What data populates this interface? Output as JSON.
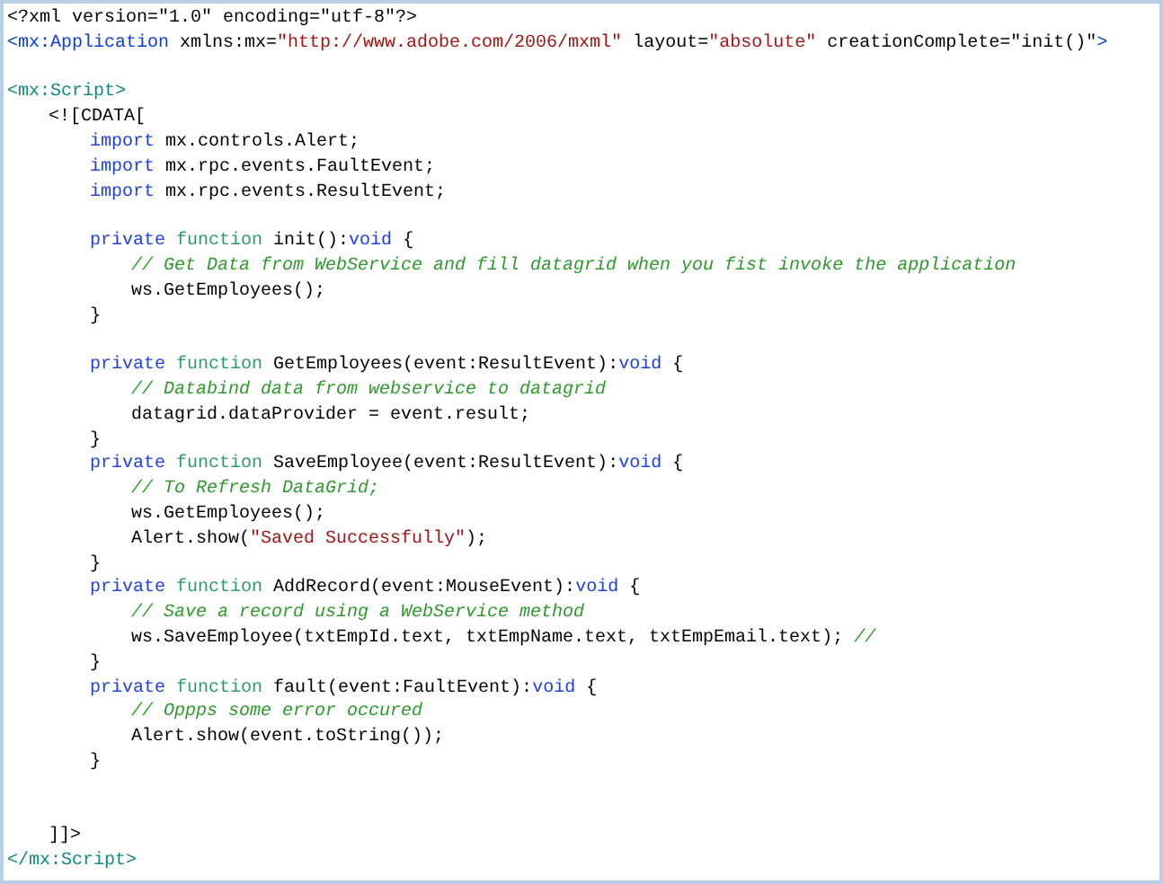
{
  "code_lines": [
    {
      "kind": "top",
      "tokens": [
        {
          "kind": "plain",
          "text": "<?xml version=\"1.0\" encoding=\"utf-8\"?>"
        }
      ]
    },
    {
      "kind": "top",
      "tokens": [
        {
          "kind": "tag",
          "text": "<mx:Application"
        },
        {
          "kind": "plain",
          "text": " xmlns:mx="
        },
        {
          "kind": "string",
          "text": "\"http://www.adobe.com/2006/mxml\""
        },
        {
          "kind": "plain",
          "text": " layout="
        },
        {
          "kind": "string",
          "text": "\"absolute\""
        },
        {
          "kind": "plain",
          "text": " creationComplete=\"init()\""
        },
        {
          "kind": "tag",
          "text": ">"
        }
      ]
    },
    {
      "kind": "blank"
    },
    {
      "kind": "top",
      "tokens": [
        {
          "kind": "script_tag",
          "text": "<mx:Script>"
        }
      ]
    },
    {
      "kind": "block",
      "tokens": [
        {
          "kind": "plain",
          "text": "<![CDATA["
        }
      ]
    },
    {
      "kind": "member",
      "tokens": [
        {
          "kind": "keyword",
          "text": "import"
        },
        {
          "kind": "plain",
          "text": " mx.controls.Alert;"
        }
      ]
    },
    {
      "kind": "member",
      "tokens": [
        {
          "kind": "keyword",
          "text": "import"
        },
        {
          "kind": "plain",
          "text": " mx.rpc.events.FaultEvent;"
        }
      ]
    },
    {
      "kind": "member",
      "tokens": [
        {
          "kind": "keyword",
          "text": "import"
        },
        {
          "kind": "plain",
          "text": " mx.rpc.events.ResultEvent;"
        }
      ]
    },
    {
      "kind": "blank"
    },
    {
      "kind": "member",
      "tokens": [
        {
          "kind": "keyword",
          "text": "private"
        },
        {
          "kind": "function_keyword",
          "text": " function"
        },
        {
          "kind": "plain",
          "text": " init():"
        },
        {
          "kind": "keyword",
          "text": "void"
        },
        {
          "kind": "plain",
          "text": " {"
        }
      ]
    },
    {
      "kind": "body",
      "tokens": [
        {
          "kind": "comment",
          "text": "// Get Data from WebService and fill datagrid when you fist invoke the application"
        }
      ]
    },
    {
      "kind": "body",
      "tokens": [
        {
          "kind": "plain",
          "text": "ws.GetEmployees();"
        }
      ]
    },
    {
      "kind": "member",
      "tokens": [
        {
          "kind": "plain",
          "text": "}"
        }
      ]
    },
    {
      "kind": "blank"
    },
    {
      "kind": "member",
      "tokens": [
        {
          "kind": "keyword",
          "text": "private"
        },
        {
          "kind": "function_keyword",
          "text": " function"
        },
        {
          "kind": "plain",
          "text": " GetEmployees(event:ResultEvent):"
        },
        {
          "kind": "keyword",
          "text": "void"
        },
        {
          "kind": "plain",
          "text": " {"
        }
      ]
    },
    {
      "kind": "body",
      "tokens": [
        {
          "kind": "comment",
          "text": "// Databind data from webservice to datagrid"
        }
      ]
    },
    {
      "kind": "body",
      "tokens": [
        {
          "kind": "plain",
          "text": "datagrid.dataProvider = event.result;"
        }
      ]
    },
    {
      "kind": "member",
      "tokens": [
        {
          "kind": "plain",
          "text": "}"
        }
      ]
    },
    {
      "kind": "member",
      "tokens": [
        {
          "kind": "keyword",
          "text": "private"
        },
        {
          "kind": "function_keyword",
          "text": " function"
        },
        {
          "kind": "plain",
          "text": " SaveEmployee(event:ResultEvent):"
        },
        {
          "kind": "keyword",
          "text": "void"
        },
        {
          "kind": "plain",
          "text": " {"
        }
      ]
    },
    {
      "kind": "body",
      "tokens": [
        {
          "kind": "comment",
          "text": "// To Refresh DataGrid;"
        }
      ]
    },
    {
      "kind": "body",
      "tokens": [
        {
          "kind": "plain",
          "text": "ws.GetEmployees();"
        }
      ]
    },
    {
      "kind": "body",
      "tokens": [
        {
          "kind": "plain",
          "text": "Alert.show("
        },
        {
          "kind": "string",
          "text": "\"Saved Successfully\""
        },
        {
          "kind": "plain",
          "text": ");"
        }
      ]
    },
    {
      "kind": "member",
      "tokens": [
        {
          "kind": "plain",
          "text": "}"
        }
      ]
    },
    {
      "kind": "member",
      "tokens": [
        {
          "kind": "keyword",
          "text": "private"
        },
        {
          "kind": "function_keyword",
          "text": " function"
        },
        {
          "kind": "plain",
          "text": " AddRecord(event:MouseEvent):"
        },
        {
          "kind": "keyword",
          "text": "void"
        },
        {
          "kind": "plain",
          "text": " {"
        }
      ]
    },
    {
      "kind": "body",
      "tokens": [
        {
          "kind": "comment",
          "text": "// Save a record using a WebService method"
        }
      ]
    },
    {
      "kind": "body",
      "tokens": [
        {
          "kind": "plain",
          "text": "ws.SaveEmployee(txtEmpId.text, txtEmpName.text, txtEmpEmail.text); "
        },
        {
          "kind": "comment",
          "text": "//"
        }
      ]
    },
    {
      "kind": "member",
      "tokens": [
        {
          "kind": "plain",
          "text": "}"
        }
      ]
    },
    {
      "kind": "member",
      "tokens": [
        {
          "kind": "keyword",
          "text": "private"
        },
        {
          "kind": "function_keyword",
          "text": " function"
        },
        {
          "kind": "plain",
          "text": " fault(event:FaultEvent):"
        },
        {
          "kind": "keyword",
          "text": "void"
        },
        {
          "kind": "plain",
          "text": " {"
        }
      ]
    },
    {
      "kind": "body",
      "tokens": [
        {
          "kind": "comment",
          "text": "// Oppps some error occured"
        }
      ]
    },
    {
      "kind": "body",
      "tokens": [
        {
          "kind": "plain",
          "text": "Alert.show(event.toString());"
        }
      ]
    },
    {
      "kind": "member",
      "tokens": [
        {
          "kind": "plain",
          "text": "}"
        }
      ]
    },
    {
      "kind": "blank"
    },
    {
      "kind": "blank"
    },
    {
      "kind": "block",
      "tokens": [
        {
          "kind": "plain",
          "text": "]]>"
        }
      ]
    },
    {
      "kind": "top",
      "tokens": [
        {
          "kind": "script_tag",
          "text": "</mx:Script>"
        }
      ]
    }
  ]
}
